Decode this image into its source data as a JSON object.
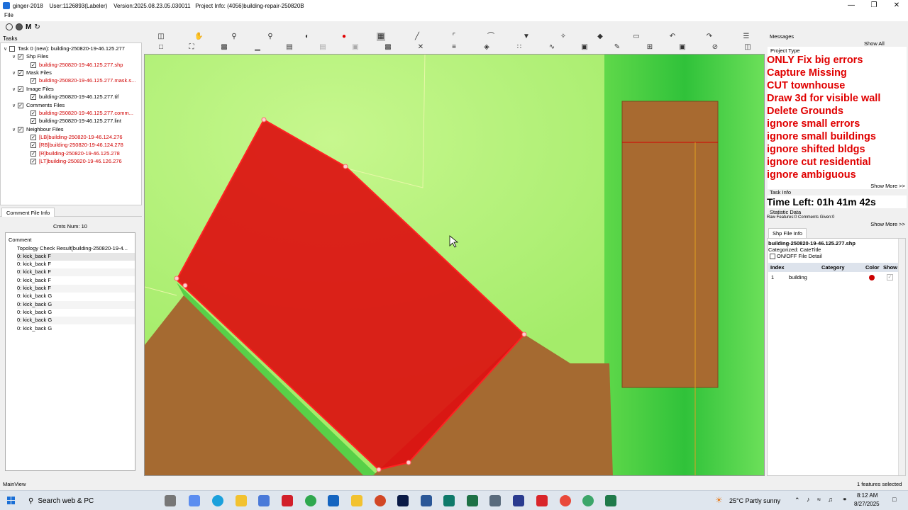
{
  "titlebar": {
    "text": "ginger-2018    User:1126893(Labeler)    Version:2025.08.23.05.030011   Project Info: (4056)building-repair-250820B"
  },
  "menu": {
    "file": "File"
  },
  "quickbar": {
    "m_label": "M"
  },
  "tasks": {
    "label": "Tasks",
    "rows": [
      {
        "label": "Task 0 (new): building-250820-19-46.125.277",
        "checked": false,
        "red": false
      },
      {
        "label": "Shp Files",
        "checked": true,
        "red": false
      },
      {
        "label": "building-250820-19-46.125.277.shp",
        "checked": true,
        "red": true
      },
      {
        "label": "Mask Files",
        "checked": true,
        "red": false
      },
      {
        "label": "building-250820-19-46.125.277.mask.s...",
        "checked": true,
        "red": true
      },
      {
        "label": "Image Files",
        "checked": true,
        "red": false
      },
      {
        "label": "building-250820-19-46.125.277.tif",
        "checked": true,
        "red": false
      },
      {
        "label": "Comments Files",
        "checked": true,
        "red": false
      },
      {
        "label": "building-250820-19-46.125.277.comm...",
        "checked": true,
        "red": true
      },
      {
        "label": "building-250820-19-46.125.277.lint",
        "checked": true,
        "red": false
      },
      {
        "label": "Neighbour Files",
        "checked": true,
        "red": false
      },
      {
        "label": "[LB]building-250820-19-46.124.276",
        "checked": true,
        "red": true
      },
      {
        "label": "[RB]building-250820-19-46.124.278",
        "checked": true,
        "red": true
      },
      {
        "label": "[R]building-250820-19-46.125.278",
        "checked": true,
        "red": true
      },
      {
        "label": "[LT]building-250820-19-46.126.276",
        "checked": true,
        "red": true
      }
    ]
  },
  "comment_panel": {
    "tab": "Comment File Info",
    "cmts_num": "Cmts Num:  10",
    "header": "Comment",
    "rows": [
      "Topology Check Result[building-250820-19-4...",
      "0: kick_back F",
      "0: kick_back F",
      "0: kick_back F",
      "0: kick_back F",
      "0: kick_back F",
      "0: kick_back G",
      "0: kick_back G",
      "0: kick_back G",
      "0: kick_back G",
      "0: kick_back G"
    ]
  },
  "right_panel": {
    "messages": "Messages",
    "show_all": "Show All Messages",
    "project_type": "Project Type",
    "project_lines": [
      "ONLY Fix big errors",
      "Capture Missing",
      "CUT townhouse",
      "Draw 3d for visible wall",
      "Delete Grounds",
      "ignore small errors",
      "ignore small buildings",
      "ignore shifted bldgs",
      "ignore cut residential",
      "ignore ambiguous"
    ],
    "show_more": "Show More >>",
    "task_info": "Task Info",
    "time_left": "Time Left: 01h 41m 42s",
    "statistic_data": "Statistic Data",
    "raw_features": "Raw Features:0 Comments Given:0",
    "shp_tab": "Shp File Info",
    "shp_name": "building-250820-19-46.125.277.shp",
    "categorized": "Categorized: CateTitle",
    "onoff": "ON/OFF File Detail",
    "table_headers": [
      "Index",
      "Category",
      "Color",
      "Show"
    ],
    "table_row": {
      "index": "1",
      "category": "building",
      "color": "#cc0000"
    }
  },
  "status": {
    "left": "MainView",
    "right": "1 features selected"
  },
  "taskbar": {
    "search": "Search web & PC",
    "weather": "25°C  Partly sunny",
    "time": "8:12 AM",
    "date": "8/27/2025"
  },
  "colors": {
    "selected_polygon": "#dd1111",
    "brown_building": "#a86a30",
    "grass": "#b9f27a",
    "project_text": "#e00000"
  }
}
